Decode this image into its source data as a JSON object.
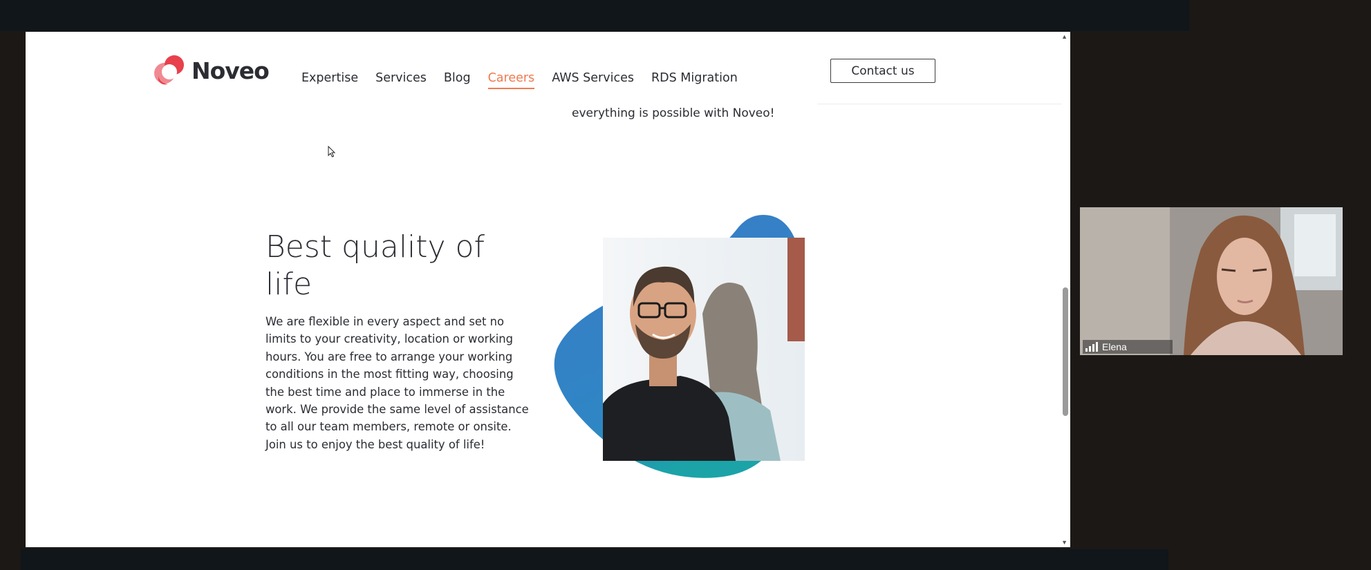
{
  "brand": {
    "name": "Noveo",
    "accent_color": "#f07a4f",
    "logo_colors": [
      "#e8404c",
      "#f08a92"
    ]
  },
  "nav": {
    "items": [
      {
        "label": "Expertise",
        "active": false
      },
      {
        "label": "Services",
        "active": false
      },
      {
        "label": "Blog",
        "active": false
      },
      {
        "label": "Careers",
        "active": true
      },
      {
        "label": "AWS Services",
        "active": false
      },
      {
        "label": "RDS Migration",
        "active": false
      }
    ],
    "contact_label": "Contact us"
  },
  "content": {
    "previous_section_tail": "everything is possible with Noveo!",
    "section_title": "Best quality of life",
    "section_body": "We are flexible in every aspect and set no limits to your creativity, location or working hours. You are free to arrange your working conditions in the most fitting way, choosing the best time and place to immerse in the work. We provide the same level of assistance to all our team members, remote or onsite. Join us to enjoy the best quality of life!"
  },
  "video_call": {
    "participant_name": "Elena",
    "icon": "signal-bars-icon"
  },
  "colors": {
    "blob_blue": "#3a7bc8",
    "blob_teal": "#1ba3a8"
  }
}
